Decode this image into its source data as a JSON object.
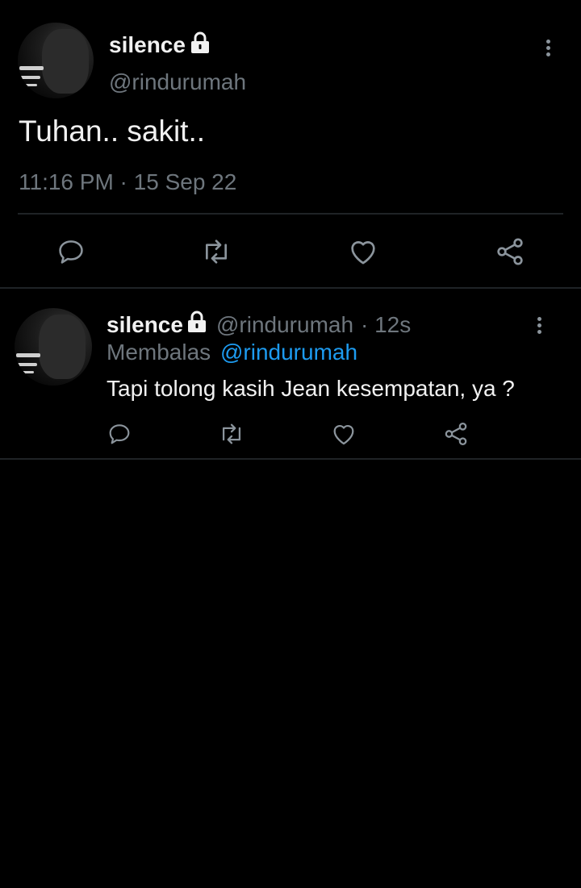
{
  "main_tweet": {
    "display_name": "silence",
    "handle": "@rindurumah",
    "text": "Tuhan.. sakit..",
    "timestamp": "11:16 PM · 15 Sep 22",
    "icons": [
      "lock-icon",
      "more-icon",
      "reply-icon",
      "retweet-icon",
      "like-icon",
      "share-icon"
    ]
  },
  "reply_tweet": {
    "display_name": "silence",
    "handle": "@rindurumah",
    "time_ago": "· 12s",
    "replying_prefix": "Membalas",
    "replying_to": "@rindurumah",
    "text": "Tapi tolong kasih Jean kesempatan, ya ?"
  },
  "colors": {
    "background": "#000000",
    "text": "#e7e9ea",
    "muted": "#6e767d",
    "accent": "#1d9bf0",
    "divider": "#1f2326"
  }
}
